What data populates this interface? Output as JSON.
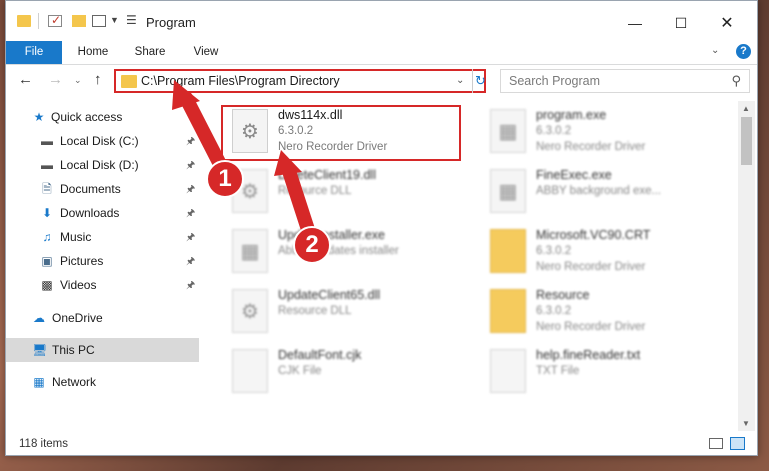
{
  "window": {
    "title": "Program"
  },
  "ribbon": {
    "tabs": [
      "File",
      "Home",
      "Share",
      "View"
    ]
  },
  "address": {
    "path": "C:\\Program Files\\Program Directory"
  },
  "search": {
    "placeholder": "Search Program"
  },
  "sidebar": {
    "items": [
      {
        "label": "Quick access",
        "icon": "star-icon"
      },
      {
        "label": "Local Disk (C:)",
        "icon": "drive-icon"
      },
      {
        "label": "Local Disk (D:)",
        "icon": "drive-icon"
      },
      {
        "label": "Documents",
        "icon": "document-icon"
      },
      {
        "label": "Downloads",
        "icon": "download-icon"
      },
      {
        "label": "Music",
        "icon": "music-icon"
      },
      {
        "label": "Pictures",
        "icon": "picture-icon"
      },
      {
        "label": "Videos",
        "icon": "video-icon"
      },
      {
        "label": "OneDrive",
        "icon": "cloud-icon"
      },
      {
        "label": "This PC",
        "icon": "computer-icon"
      },
      {
        "label": "Network",
        "icon": "network-icon"
      }
    ]
  },
  "files": [
    {
      "name": "dws114x.dll",
      "line2": "6.3.0.2",
      "line3": "Nero Recorder Driver"
    },
    {
      "name": "program.exe",
      "line2": "6.3.0.2",
      "line3": "Nero Recorder Driver"
    },
    {
      "name": "DeleteClient19.dll",
      "line2": "Resource DLL",
      "line3": ""
    },
    {
      "name": "FineExec.exe",
      "line2": "ABBY background exe...",
      "line3": ""
    },
    {
      "name": "UpdateInstaller.exe",
      "line2": "Abbyy Updates installer",
      "line3": ""
    },
    {
      "name": "Microsoft.VC90.CRT",
      "line2": "6.3.0.2",
      "line3": "Nero Recorder Driver"
    },
    {
      "name": "UpdateClient65.dll",
      "line2": "Resource DLL",
      "line3": ""
    },
    {
      "name": "Resource",
      "line2": "6.3.0.2",
      "line3": "Nero Recorder Driver"
    },
    {
      "name": "DefaultFont.cjk",
      "line2": "CJK File",
      "line3": ""
    },
    {
      "name": "help.fineReader.txt",
      "line2": "TXT File",
      "line3": ""
    }
  ],
  "status": {
    "item_count": "118 items"
  },
  "annotations": {
    "step1": "1",
    "step2": "2"
  },
  "colors": {
    "accent": "#1979ca",
    "highlight": "#d62828",
    "folder": "#f4c64c"
  }
}
